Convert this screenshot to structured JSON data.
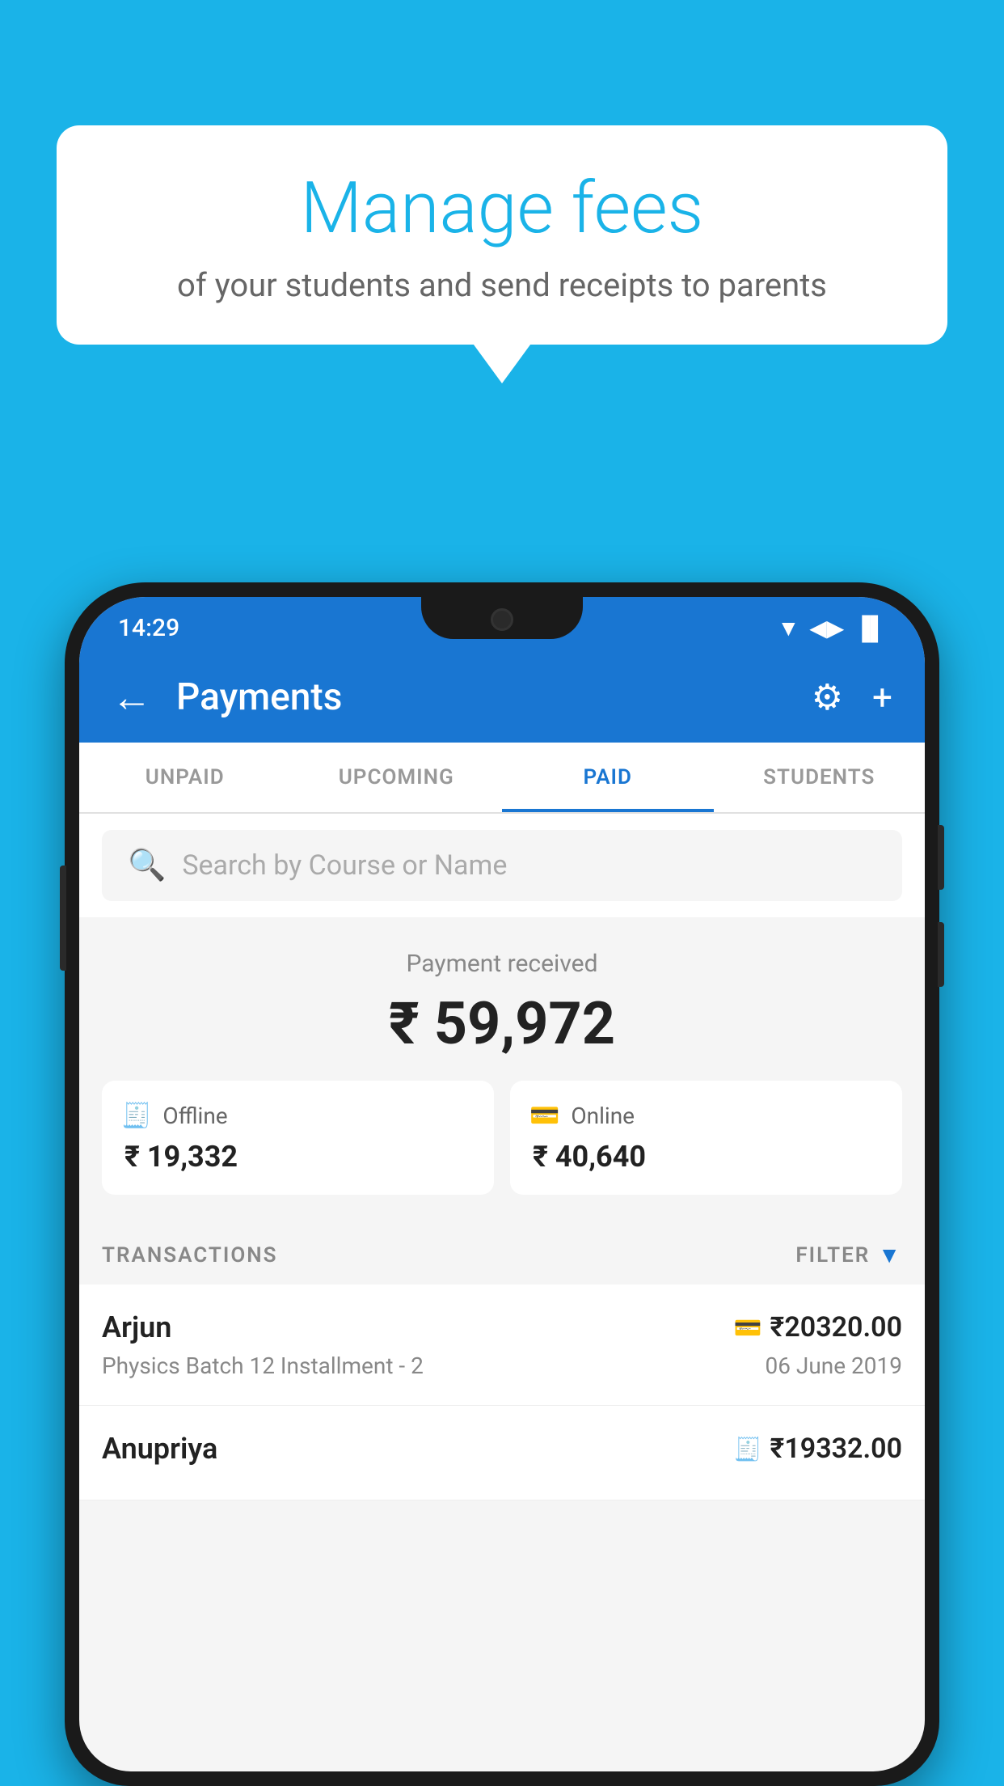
{
  "background_color": "#1ab3e8",
  "bubble": {
    "title": "Manage fees",
    "subtitle": "of your students and send receipts to parents"
  },
  "status_bar": {
    "time": "14:29",
    "wifi": "▼",
    "signal": "▲",
    "battery": "▐"
  },
  "app_bar": {
    "title": "Payments",
    "back_icon": "←",
    "settings_icon": "⚙",
    "add_icon": "+"
  },
  "tabs": [
    {
      "label": "UNPAID",
      "active": false
    },
    {
      "label": "UPCOMING",
      "active": false
    },
    {
      "label": "PAID",
      "active": true
    },
    {
      "label": "STUDENTS",
      "active": false
    }
  ],
  "search": {
    "placeholder": "Search by Course or Name"
  },
  "payment_summary": {
    "label": "Payment received",
    "total": "₹ 59,972",
    "offline": {
      "label": "Offline",
      "amount": "₹ 19,332"
    },
    "online": {
      "label": "Online",
      "amount": "₹ 40,640"
    }
  },
  "transactions": {
    "header_label": "TRANSACTIONS",
    "filter_label": "FILTER",
    "items": [
      {
        "name": "Arjun",
        "course": "Physics Batch 12 Installment - 2",
        "date": "06 June 2019",
        "amount": "₹20320.00",
        "type": "online"
      },
      {
        "name": "Anupriya",
        "course": "",
        "date": "",
        "amount": "₹19332.00",
        "type": "offline"
      }
    ]
  }
}
